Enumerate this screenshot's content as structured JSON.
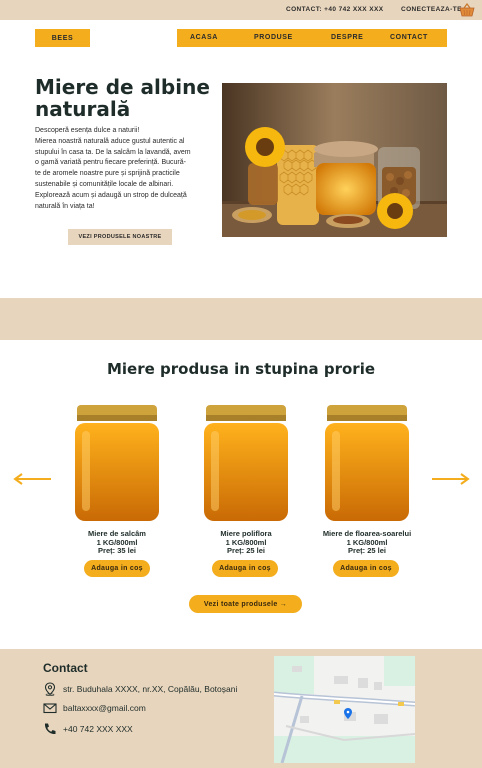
{
  "topbar": {
    "phone": "CONTACT: +40 742 XXX XXX",
    "login": "CONECTEAZA-TE",
    "cart_icon": "basket-icon"
  },
  "nav": {
    "logo": "BEES",
    "items": [
      "ACASA",
      "PRODUSE",
      "DESPRE",
      "CONTACT"
    ]
  },
  "hero": {
    "title": "Miere de albine naturală",
    "lines": [
      "Descoperă esența dulce a naturii!",
      "Mierea noastră naturală aduce gustul autentic al",
      "stupului în casa ta. De la salcâm la lavandă, avem",
      "o gamă variată pentru fiecare preferință. Bucură-",
      "te de aromele noastre pure și sprijină practicile",
      "sustenabile și comunitățile locale de albinari.",
      "Explorează acum și adaugă un strop de dulceață",
      "naturală în viața ta!"
    ],
    "button": "VEZI PRODUSELE NOASTRE"
  },
  "products": {
    "title": "Miere produsa in stupina prorie",
    "items": [
      {
        "name": "Miere de salcâm",
        "size": "1 KG/800ml",
        "price": "Preț: 35 lei",
        "button": "Adauga in coș"
      },
      {
        "name": "Miere poliflora",
        "size": "1 KG/800ml",
        "price": "Preț: 25 lei",
        "button": "Adauga in coș"
      },
      {
        "name": "Miere de floarea-soarelui",
        "size": "1 KG/800ml",
        "price": "Preț: 25 lei",
        "button": "Adauga in coș"
      }
    ],
    "all_button": "Vezi toate produsele →",
    "prev_icon": "arrow-left-icon",
    "next_icon": "arrow-right-icon"
  },
  "contact": {
    "title": "Contact",
    "address": "str. Buduhala XXXX, nr.XX, Copălău, Botoșani",
    "email": "baltaxxxx@gmail.com",
    "phone": "+40 742 XXX XXX",
    "icons": [
      "location-pin-icon",
      "mail-icon",
      "phone-icon"
    ]
  },
  "colors": {
    "accent": "#f3ad1d",
    "beige": "#e8d5bd",
    "dark": "#1f2d2a"
  }
}
